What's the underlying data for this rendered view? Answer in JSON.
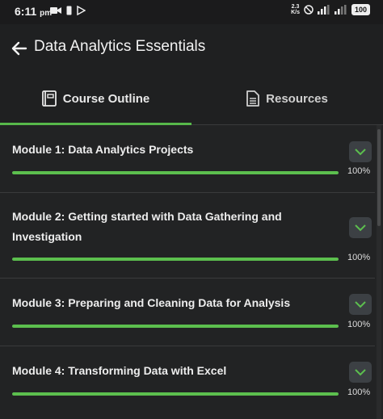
{
  "status_bar": {
    "time": "6:11",
    "ampm": "pm",
    "net_speed_top": "2.3",
    "net_speed_bottom": "K/s",
    "battery": "100",
    "icons": [
      "video-camera-icon",
      "phone-icon",
      "play-store-icon",
      "dnd-icon",
      "signal-icon",
      "wifi-signal-icon",
      "battery-icon"
    ]
  },
  "app_bar": {
    "title": "Data Analytics Essentials"
  },
  "tabs": [
    {
      "label": "Course Outline",
      "icon": "book-icon",
      "selected": true
    },
    {
      "label": "Resources",
      "icon": "document-icon",
      "selected": false
    }
  ],
  "modules": [
    {
      "title": "Module 1: Data Analytics Projects",
      "progress_text": "100%",
      "progress": 1.0
    },
    {
      "title": "Module 2: Getting started with Data Gathering and Investigation",
      "progress_text": "100%",
      "progress": 1.0
    },
    {
      "title": "Module 3: Preparing and Cleaning Data for Analysis",
      "progress_text": "100%",
      "progress": 1.0
    },
    {
      "title": "Module 4: Transforming Data with Excel",
      "progress_text": "100%",
      "progress": 1.0
    }
  ],
  "colors": {
    "accent_green": "#5cbf4e",
    "background": "#222324",
    "button_bg": "#3c4044"
  }
}
